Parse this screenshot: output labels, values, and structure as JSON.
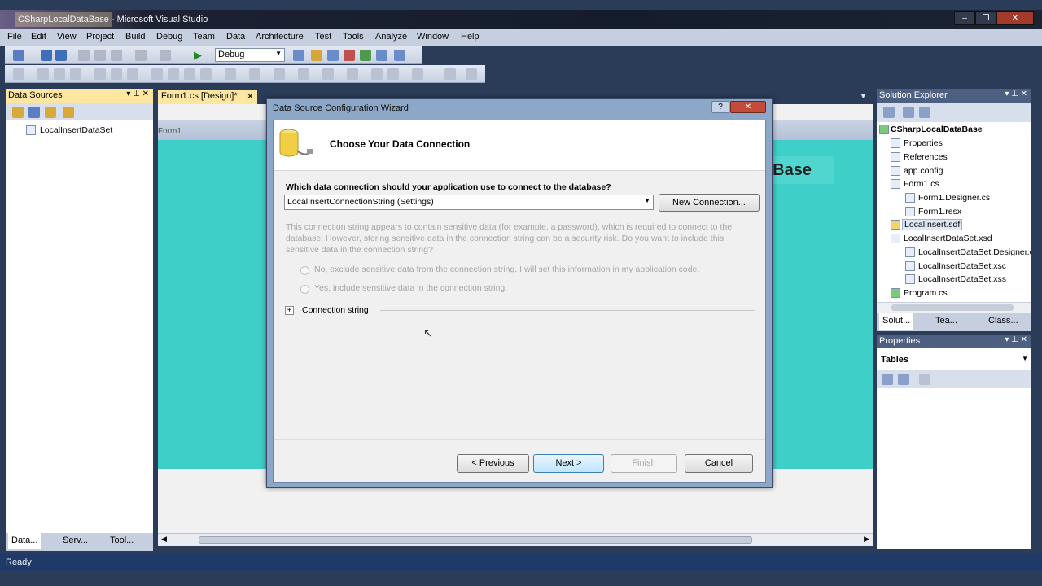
{
  "window": {
    "title": "CSharpLocalDataBase - Microsoft Visual Studio"
  },
  "menu": [
    "File",
    "Edit",
    "View",
    "Project",
    "Build",
    "Debug",
    "Team",
    "Data",
    "Architecture",
    "Test",
    "Tools",
    "Analyze",
    "Window",
    "Help"
  ],
  "toolbar": {
    "config": "Debug"
  },
  "data_sources": {
    "title": "Data Sources",
    "dataset": "LocalInsertDataSet",
    "tabs": [
      "Data...",
      "Serv...",
      "Tool..."
    ]
  },
  "editor": {
    "tab": "Form1.cs [Design]*",
    "form_caption": "Form1",
    "form_label_fragment": "aBase"
  },
  "dialog": {
    "title": "Data Source Configuration Wizard",
    "heading": "Choose Your Data Connection",
    "question": "Which data connection should your application use to connect to the database?",
    "connection": "LocalInsertConnectionString (Settings)",
    "new_connection": "New Connection...",
    "sensitive_text": "This connection string appears to contain sensitive data (for example, a password), which is required to connect to the database. However, storing sensitive data in the connection string can be a security risk. Do you want to include this sensitive data in the connection string?",
    "option_no": "No, exclude sensitive data from the connection string. I will set this information in my application code.",
    "option_yes": "Yes, include sensitive data in the connection string.",
    "expander": "+",
    "connection_string_label": "Connection string",
    "previous": "< Previous",
    "next": "Next >",
    "finish": "Finish",
    "cancel": "Cancel"
  },
  "solution_explorer": {
    "title": "Solution Explorer",
    "items": [
      "CSharpLocalDataBase",
      "Properties",
      "References",
      "app.config",
      "Form1.cs",
      "Form1.Designer.cs",
      "Form1.resx",
      "LocalInsert.sdf",
      "LocalInsertDataSet.xsd",
      "LocalInsertDataSet.Designer.cs",
      "LocalInsertDataSet.xsc",
      "LocalInsertDataSet.xss",
      "Program.cs"
    ],
    "tabs": [
      "Solut...",
      "Tea...",
      "Class..."
    ]
  },
  "properties": {
    "title": "Properties",
    "object": "Tables"
  },
  "status": {
    "text": "Ready"
  },
  "colors": {
    "form_teal": "#3ecfc8",
    "pane_header_active": "#fde7a0",
    "status_bar": "#1f3a68"
  }
}
